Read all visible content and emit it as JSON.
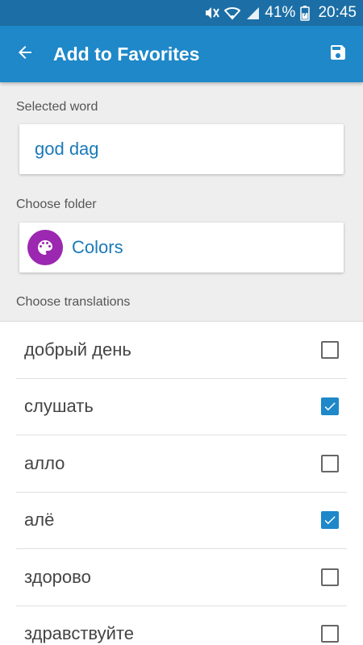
{
  "status_bar": {
    "battery": "41%",
    "time": "20:45",
    "icons": [
      "mute-icon",
      "wifi-icon",
      "signal-icon",
      "battery-icon"
    ]
  },
  "app_bar": {
    "title": "Add to Favorites",
    "back_icon": "arrow-back-icon",
    "save_icon": "save-icon"
  },
  "selected_word": {
    "label": "Selected word",
    "value": "god dag"
  },
  "folder": {
    "label": "Choose folder",
    "name": "Colors",
    "icon": "palette-icon",
    "icon_color": "#9c27b0"
  },
  "translations": {
    "label": "Choose translations",
    "items": [
      {
        "text": "добрый день",
        "checked": false
      },
      {
        "text": "слушать",
        "checked": true
      },
      {
        "text": "алло",
        "checked": false
      },
      {
        "text": "алё",
        "checked": true
      },
      {
        "text": "здорово",
        "checked": false
      },
      {
        "text": "здравствуйте",
        "checked": false
      }
    ]
  },
  "colors": {
    "status_bar": "#1c6fa6",
    "app_bar": "#1e88c9",
    "accent": "#1e88c9",
    "link_text": "#1a7ab8"
  }
}
